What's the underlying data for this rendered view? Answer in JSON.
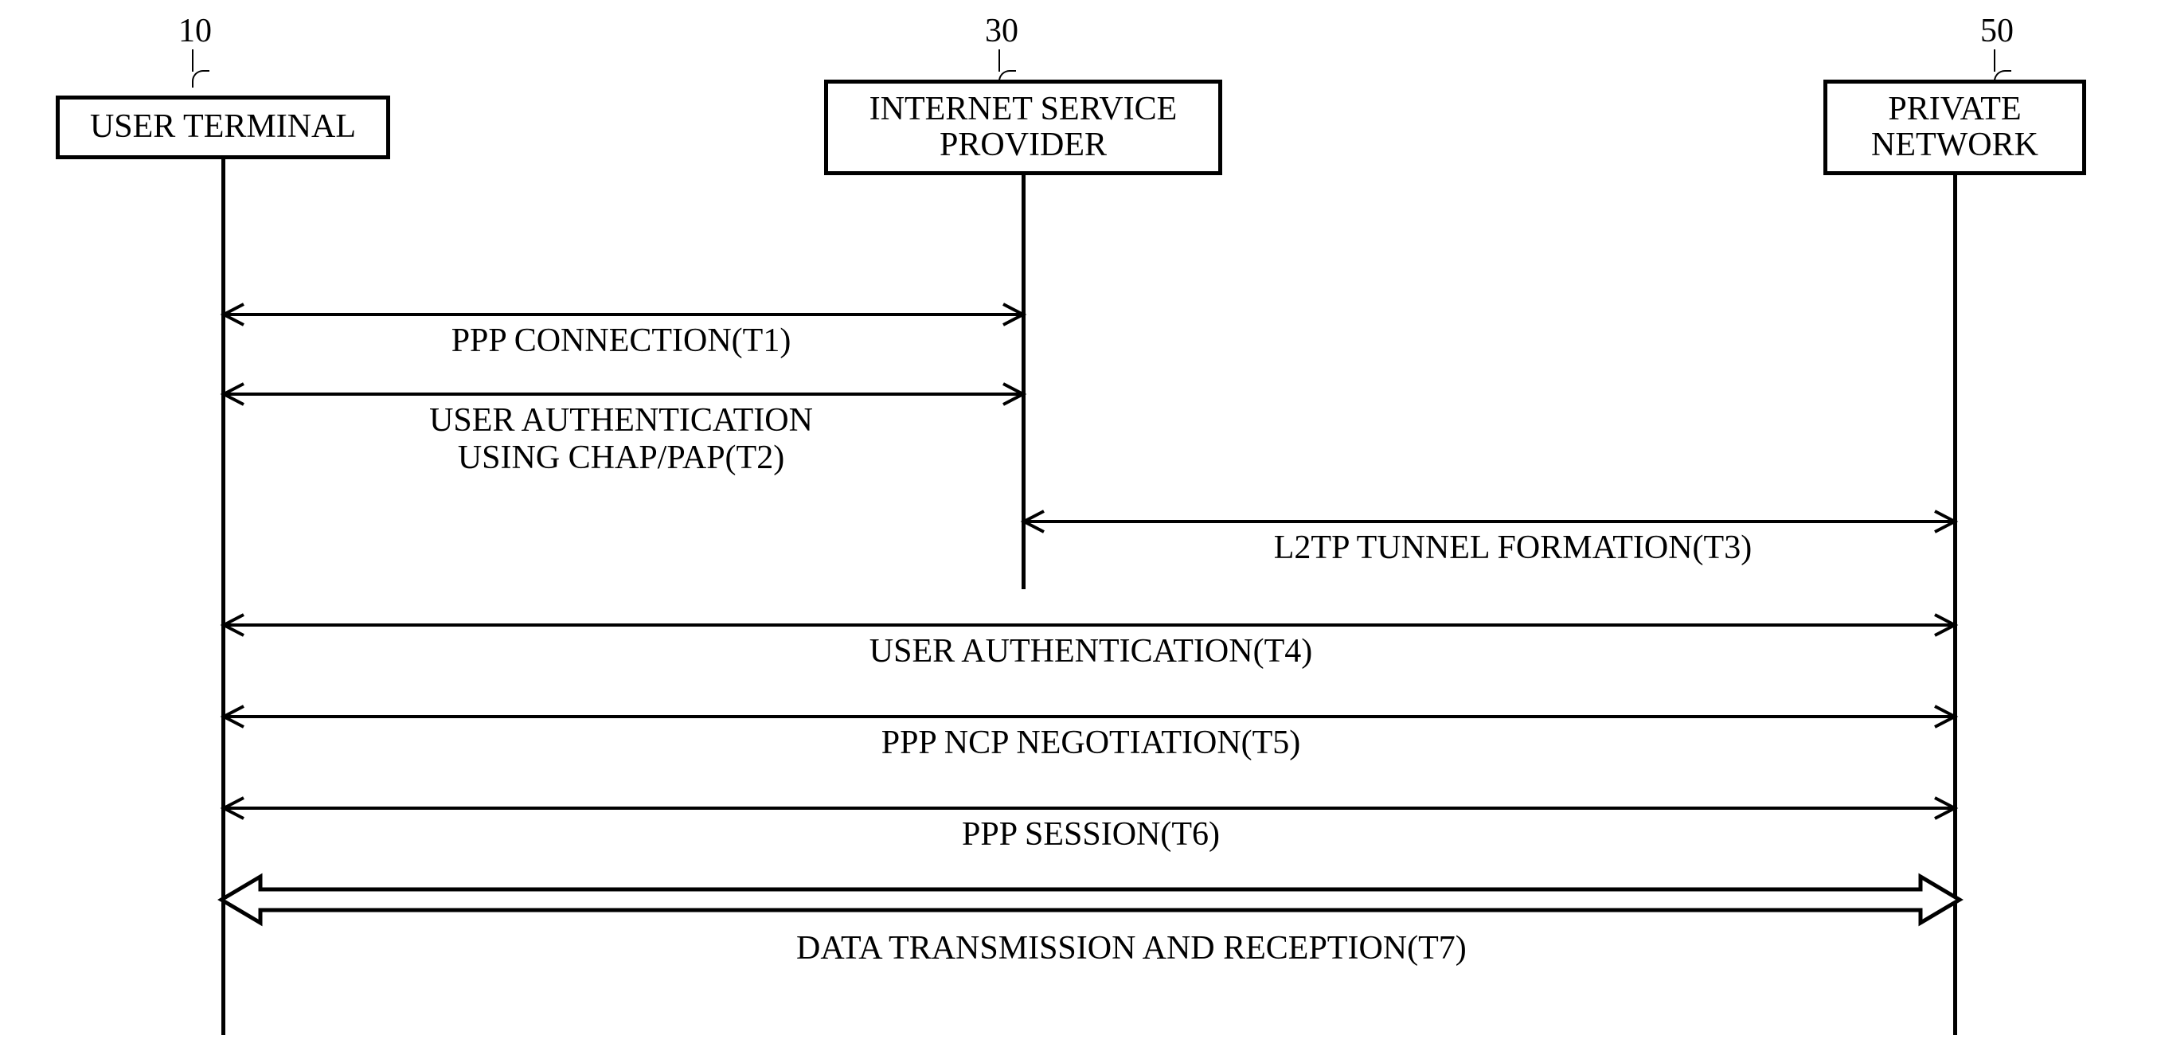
{
  "actors": {
    "user_terminal": {
      "num": "10",
      "label": "USER TERMINAL"
    },
    "isp": {
      "num": "30",
      "label": "INTERNET SERVICE\nPROVIDER"
    },
    "private_net": {
      "num": "50",
      "label": "PRIVATE\nNETWORK"
    }
  },
  "messages": {
    "t1": "PPP CONNECTION(T1)",
    "t2": "USER AUTHENTICATION\nUSING CHAP/PAP(T2)",
    "t3": "L2TP TUNNEL FORMATION(T3)",
    "t4": "USER AUTHENTICATION(T4)",
    "t5": "PPP NCP NEGOTIATION(T5)",
    "t6": "PPP SESSION(T6)",
    "t7": "DATA TRANSMISSION AND RECEPTION(T7)"
  },
  "chart_data": {
    "type": "sequence",
    "actors": [
      {
        "id": "user_terminal",
        "ref": "10",
        "label": "USER TERMINAL"
      },
      {
        "id": "isp",
        "ref": "30",
        "label": "INTERNET SERVICE PROVIDER"
      },
      {
        "id": "private_net",
        "ref": "50",
        "label": "PRIVATE NETWORK"
      }
    ],
    "messages": [
      {
        "step": "T1",
        "text": "PPP CONNECTION",
        "from": "user_terminal",
        "to": "isp",
        "bidirectional": true,
        "style": "line"
      },
      {
        "step": "T2",
        "text": "USER AUTHENTICATION USING CHAP/PAP",
        "from": "user_terminal",
        "to": "isp",
        "bidirectional": true,
        "style": "line"
      },
      {
        "step": "T3",
        "text": "L2TP TUNNEL FORMATION",
        "from": "isp",
        "to": "private_net",
        "bidirectional": true,
        "style": "line"
      },
      {
        "step": "T4",
        "text": "USER AUTHENTICATION",
        "from": "user_terminal",
        "to": "private_net",
        "bidirectional": true,
        "style": "line"
      },
      {
        "step": "T5",
        "text": "PPP NCP NEGOTIATION",
        "from": "user_terminal",
        "to": "private_net",
        "bidirectional": true,
        "style": "line"
      },
      {
        "step": "T6",
        "text": "PPP SESSION",
        "from": "user_terminal",
        "to": "private_net",
        "bidirectional": true,
        "style": "line"
      },
      {
        "step": "T7",
        "text": "DATA TRANSMISSION AND RECEPTION",
        "from": "user_terminal",
        "to": "private_net",
        "bidirectional": true,
        "style": "block-arrow"
      }
    ]
  }
}
